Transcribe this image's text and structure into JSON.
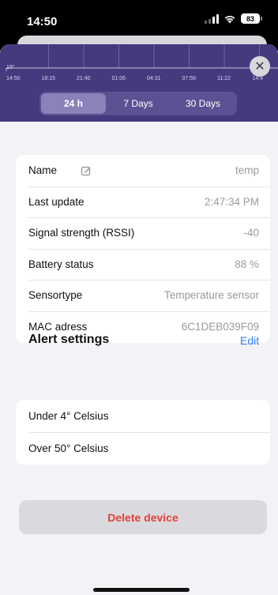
{
  "status_bar": {
    "time": "14:50",
    "battery": "83"
  },
  "chart": {
    "y_tick_label": "19°",
    "x_tick_labels": [
      "14:50",
      "18:15",
      "21:40",
      "01:06",
      "04:31",
      "07:56",
      "11:22",
      "14:4"
    ]
  },
  "range_selector": {
    "options": [
      "24 h",
      "7 Days",
      "30 Days"
    ],
    "selected": "24 h"
  },
  "device_info": {
    "rows": [
      {
        "label": "Name",
        "value": "temp"
      },
      {
        "label": "Last update",
        "value": "2:47:34 PM"
      },
      {
        "label": "Signal strength (RSSI)",
        "value": "-40"
      },
      {
        "label": "Battery status",
        "value": "88 %"
      },
      {
        "label": "Sensortype",
        "value": "Temperature sensor"
      },
      {
        "label": "MAC adress",
        "value": "6C1DEB039F09"
      }
    ]
  },
  "alert_settings": {
    "title": "Alert settings",
    "edit_label": "Edit",
    "items": [
      "Under 4° Celsius",
      "Over 50° Celsius"
    ]
  },
  "delete_button": {
    "label": "Delete device"
  },
  "colors": {
    "header": "#443a7e",
    "accent_link": "#2f7cf6",
    "destructive": "#e0423b"
  },
  "icons": [
    "signal-icon",
    "wifi-icon",
    "battery-icon",
    "close-icon",
    "pencil-icon"
  ]
}
